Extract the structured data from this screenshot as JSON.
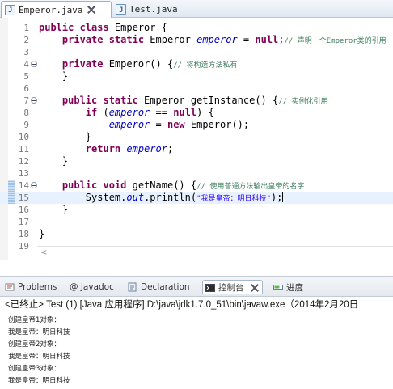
{
  "editor_tabs": [
    {
      "icon": "J",
      "label": "Emperor.java",
      "active": true
    },
    {
      "icon": "J",
      "label": "Test.java",
      "active": false
    }
  ],
  "code_lines": [
    {
      "n": "1",
      "fold": false,
      "html": "<span class=\"kw\">public class</span> Emperor {"
    },
    {
      "n": "2",
      "fold": false,
      "html": "    <span class=\"kw\">private static</span> Emperor <span class=\"fld\">emperor</span> = <span class=\"kw\">null</span>;<span class=\"cm\">// 声明一个Emperor类的引用</span>"
    },
    {
      "n": "3",
      "fold": false,
      "html": ""
    },
    {
      "n": "4",
      "fold": true,
      "html": "    <span class=\"kw\">private</span> Emperor() {<span class=\"cm\">// 将构造方法私有</span>"
    },
    {
      "n": "5",
      "fold": false,
      "html": "    }"
    },
    {
      "n": "6",
      "fold": false,
      "html": ""
    },
    {
      "n": "7",
      "fold": true,
      "html": "    <span class=\"kw\">public static</span> Emperor getInstance() {<span class=\"cm\">// 实例化引用</span>"
    },
    {
      "n": "8",
      "fold": false,
      "html": "        <span class=\"kw\">if</span> (<span class=\"fld\">emperor</span> == <span class=\"kw\">null</span>) {"
    },
    {
      "n": "9",
      "fold": false,
      "html": "            <span class=\"fld\">emperor</span> = <span class=\"kw\">new</span> Emperor();"
    },
    {
      "n": "10",
      "fold": false,
      "html": "        }"
    },
    {
      "n": "11",
      "fold": false,
      "html": "        <span class=\"kw\">return</span> <span class=\"fld\">emperor</span>;"
    },
    {
      "n": "12",
      "fold": false,
      "html": "    }"
    },
    {
      "n": "13",
      "fold": false,
      "html": ""
    },
    {
      "n": "14",
      "fold": true,
      "html": "    <span class=\"kw\">public void</span> getName() {<span class=\"cm\">// 使用普通方法输出皇帝的名字</span>"
    },
    {
      "n": "15",
      "fold": false,
      "html": "        System.<span class=\"fld\">out</span>.println(<span class=\"str\">\"我是皇帝：明日科技\"</span>);<span class=\"caret\"></span>"
    },
    {
      "n": "16",
      "fold": false,
      "html": "    }"
    },
    {
      "n": "17",
      "fold": false,
      "html": ""
    },
    {
      "n": "18",
      "fold": false,
      "html": "}"
    },
    {
      "n": "19",
      "fold": false,
      "html": ""
    }
  ],
  "view_tabs": [
    {
      "icon": "problems",
      "label": "Problems",
      "active": false
    },
    {
      "icon": "javadoc",
      "label": "@ Javadoc",
      "active": false
    },
    {
      "icon": "declaration",
      "label": "Declaration",
      "active": false
    },
    {
      "icon": "console",
      "label": "控制台",
      "active": true
    },
    {
      "icon": "progress",
      "label": "进度",
      "active": false
    }
  ],
  "console_status": "<已终止> Test (1) [Java 应用程序] D:\\java\\jdk1.7.0_51\\bin\\javaw.exe（2014年2月20日",
  "console_output": [
    "创建皇帝1对象：",
    "我是皇帝：明日科技",
    "创建皇帝2对象：",
    "我是皇帝：明日科技",
    "创建皇帝3对象：",
    "我是皇帝：明日科技"
  ],
  "colors": {
    "keyword": "#7f0055",
    "field": "#0000c0",
    "comment": "#3f7f5f",
    "string": "#2a00ff",
    "current_line": "#e8f2fe"
  }
}
